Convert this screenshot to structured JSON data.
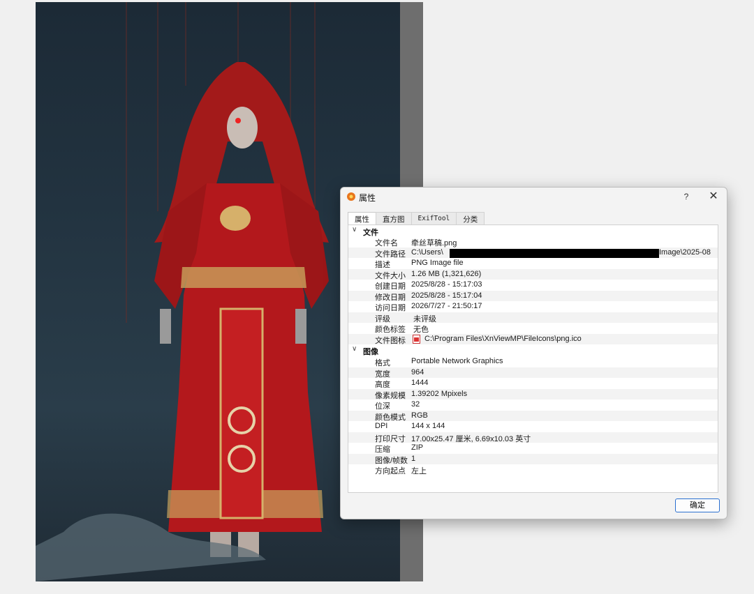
{
  "dialog": {
    "title": "属性",
    "help": "?",
    "close": "✕",
    "tabs": [
      "属性",
      "直方图",
      "ExifTool",
      "分类"
    ],
    "ok_label": "确定"
  },
  "groups": {
    "file": "文件",
    "image": "图像"
  },
  "file_props": {
    "name_key": "文件名",
    "name_val": "牵丝草稿.png",
    "path_key": "文件路径",
    "path_start": "C:\\Users\\",
    "path_end": "Image\\2025-08",
    "desc_key": "描述",
    "desc_val": "PNG Image file",
    "size_key": "文件大小",
    "size_val": "1.26 MB (1,321,626)",
    "created_key": "创建日期",
    "created_val": "2025/8/28 - 15:17:03",
    "modified_key": "修改日期",
    "modified_val": "2025/8/28 - 15:17:04",
    "accessed_key": "访问日期",
    "accessed_val": "2026/7/27 - 21:50:17",
    "rating_key": "评级",
    "rating_val": "未评级",
    "color_key": "颜色标签",
    "color_val": "无色",
    "icon_key": "文件图标",
    "icon_val": "C:\\Program Files\\XnViewMP\\FileIcons\\png.ico"
  },
  "image_props": {
    "format_key": "格式",
    "format_val": "Portable Network Graphics",
    "width_key": "宽度",
    "width_val": "964",
    "height_key": "高度",
    "height_val": "1444",
    "pixels_key": "像素规模",
    "pixels_val": "1.39202 Mpixels",
    "depth_key": "位深",
    "depth_val": "32",
    "mode_key": "颜色模式",
    "mode_val": "RGB",
    "dpi_key": "DPI",
    "dpi_val": "144 x 144",
    "print_key": "打印尺寸",
    "print_val": "17.00x25.47 厘米, 6.69x10.03 英寸",
    "compression_key": "压缩",
    "compression_val": "ZIP",
    "frames_key": "图像/帧数",
    "frames_val": "1",
    "orientation_key": "方向起点",
    "orientation_val": "左上"
  },
  "colors": {
    "accent": "#2a6fd0",
    "robe_red": "#b3181c",
    "gold": "#d6b06a"
  }
}
